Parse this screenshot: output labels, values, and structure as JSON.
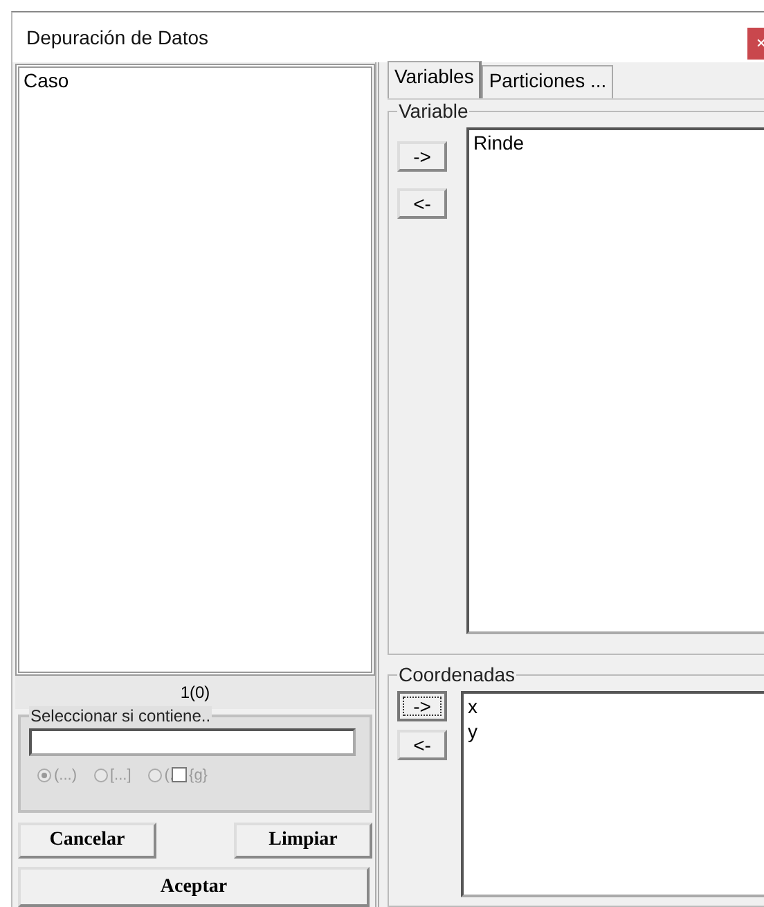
{
  "window": {
    "title": "Depuración de Datos"
  },
  "source_list": {
    "items": [
      "Caso"
    ],
    "count": "1(0)"
  },
  "filter": {
    "label": "Seleccionar si contiene..",
    "disabled": true,
    "options": [
      {
        "label": "(...)",
        "selected": true
      },
      {
        "label": "[...]",
        "selected": false
      },
      {
        "label": "(.",
        "selected": false
      }
    ],
    "checkbox": {
      "label": "{g}",
      "checked": false
    }
  },
  "buttons": [
    {
      "label": "Cancelar",
      "kind": "half"
    },
    {
      "label": "Limpiar",
      "kind": "half"
    },
    {
      "label": "Aceptar",
      "kind": "full"
    }
  ],
  "tabs": [
    {
      "label": "Variables",
      "selected": true
    },
    {
      "label": "Particiones ...",
      "selected": false
    }
  ],
  "groups": [
    {
      "title": "Variable",
      "add": "->",
      "remove": "<-",
      "focused": false,
      "items": [
        "Rinde"
      ]
    },
    {
      "title": "Coordenadas",
      "add": "->",
      "remove": "<-",
      "focused": true,
      "items": [
        "x",
        "y"
      ]
    }
  ]
}
